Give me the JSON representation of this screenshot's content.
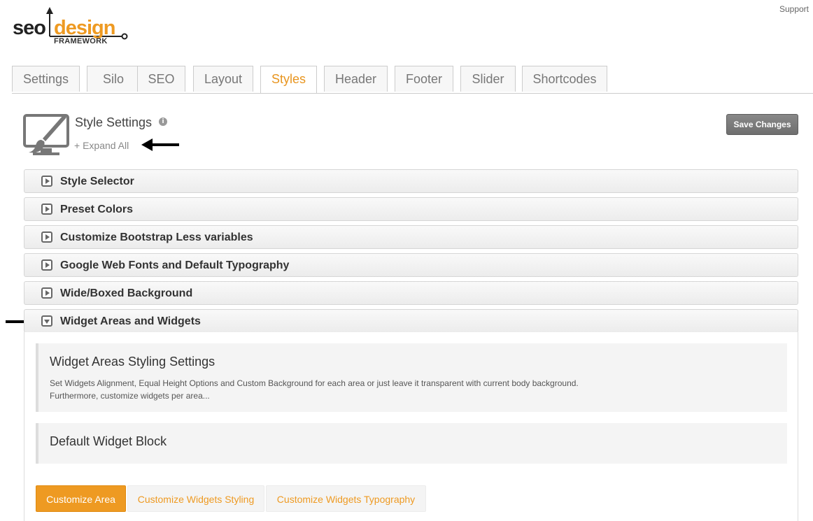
{
  "header": {
    "support_link": "Support"
  },
  "logo": {
    "part1": "seo",
    "part2": "design",
    "tagline": "FRAMEWORK"
  },
  "tabs": [
    {
      "label": "Settings"
    },
    {
      "label": "Silo"
    },
    {
      "label": "SEO"
    },
    {
      "label": "Layout"
    },
    {
      "label": "Styles",
      "active": true
    },
    {
      "label": "Header"
    },
    {
      "label": "Footer"
    },
    {
      "label": "Slider"
    },
    {
      "label": "Shortcodes"
    }
  ],
  "section": {
    "title": "Style Settings",
    "info_glyph": "i",
    "expand_all": "+ Expand All",
    "save_label": "Save Changes"
  },
  "accordion": [
    {
      "label": "Style Selector"
    },
    {
      "label": "Preset Colors"
    },
    {
      "label": "Customize Bootstrap Less variables"
    },
    {
      "label": "Google Web Fonts and Default Typography"
    },
    {
      "label": "Wide/Boxed Background"
    },
    {
      "label": "Widget Areas and Widgets",
      "open": true
    }
  ],
  "widget_panel": {
    "box1_title": "Widget Areas Styling Settings",
    "box1_line1": "Set Widgets Alignment, Equal Height Options and Custom Background for each area or just leave it transparent with current body background.",
    "box1_line2": "Furthermore, customize widgets per area...",
    "box2_title": "Default Widget Block",
    "buttons": [
      {
        "label": "Customize Area"
      },
      {
        "label": "Customize Widgets Styling"
      },
      {
        "label": "Customize Widgets Typography"
      }
    ]
  },
  "colors": {
    "accent": "#ee9a22",
    "save_button": "#7a7a7a"
  }
}
